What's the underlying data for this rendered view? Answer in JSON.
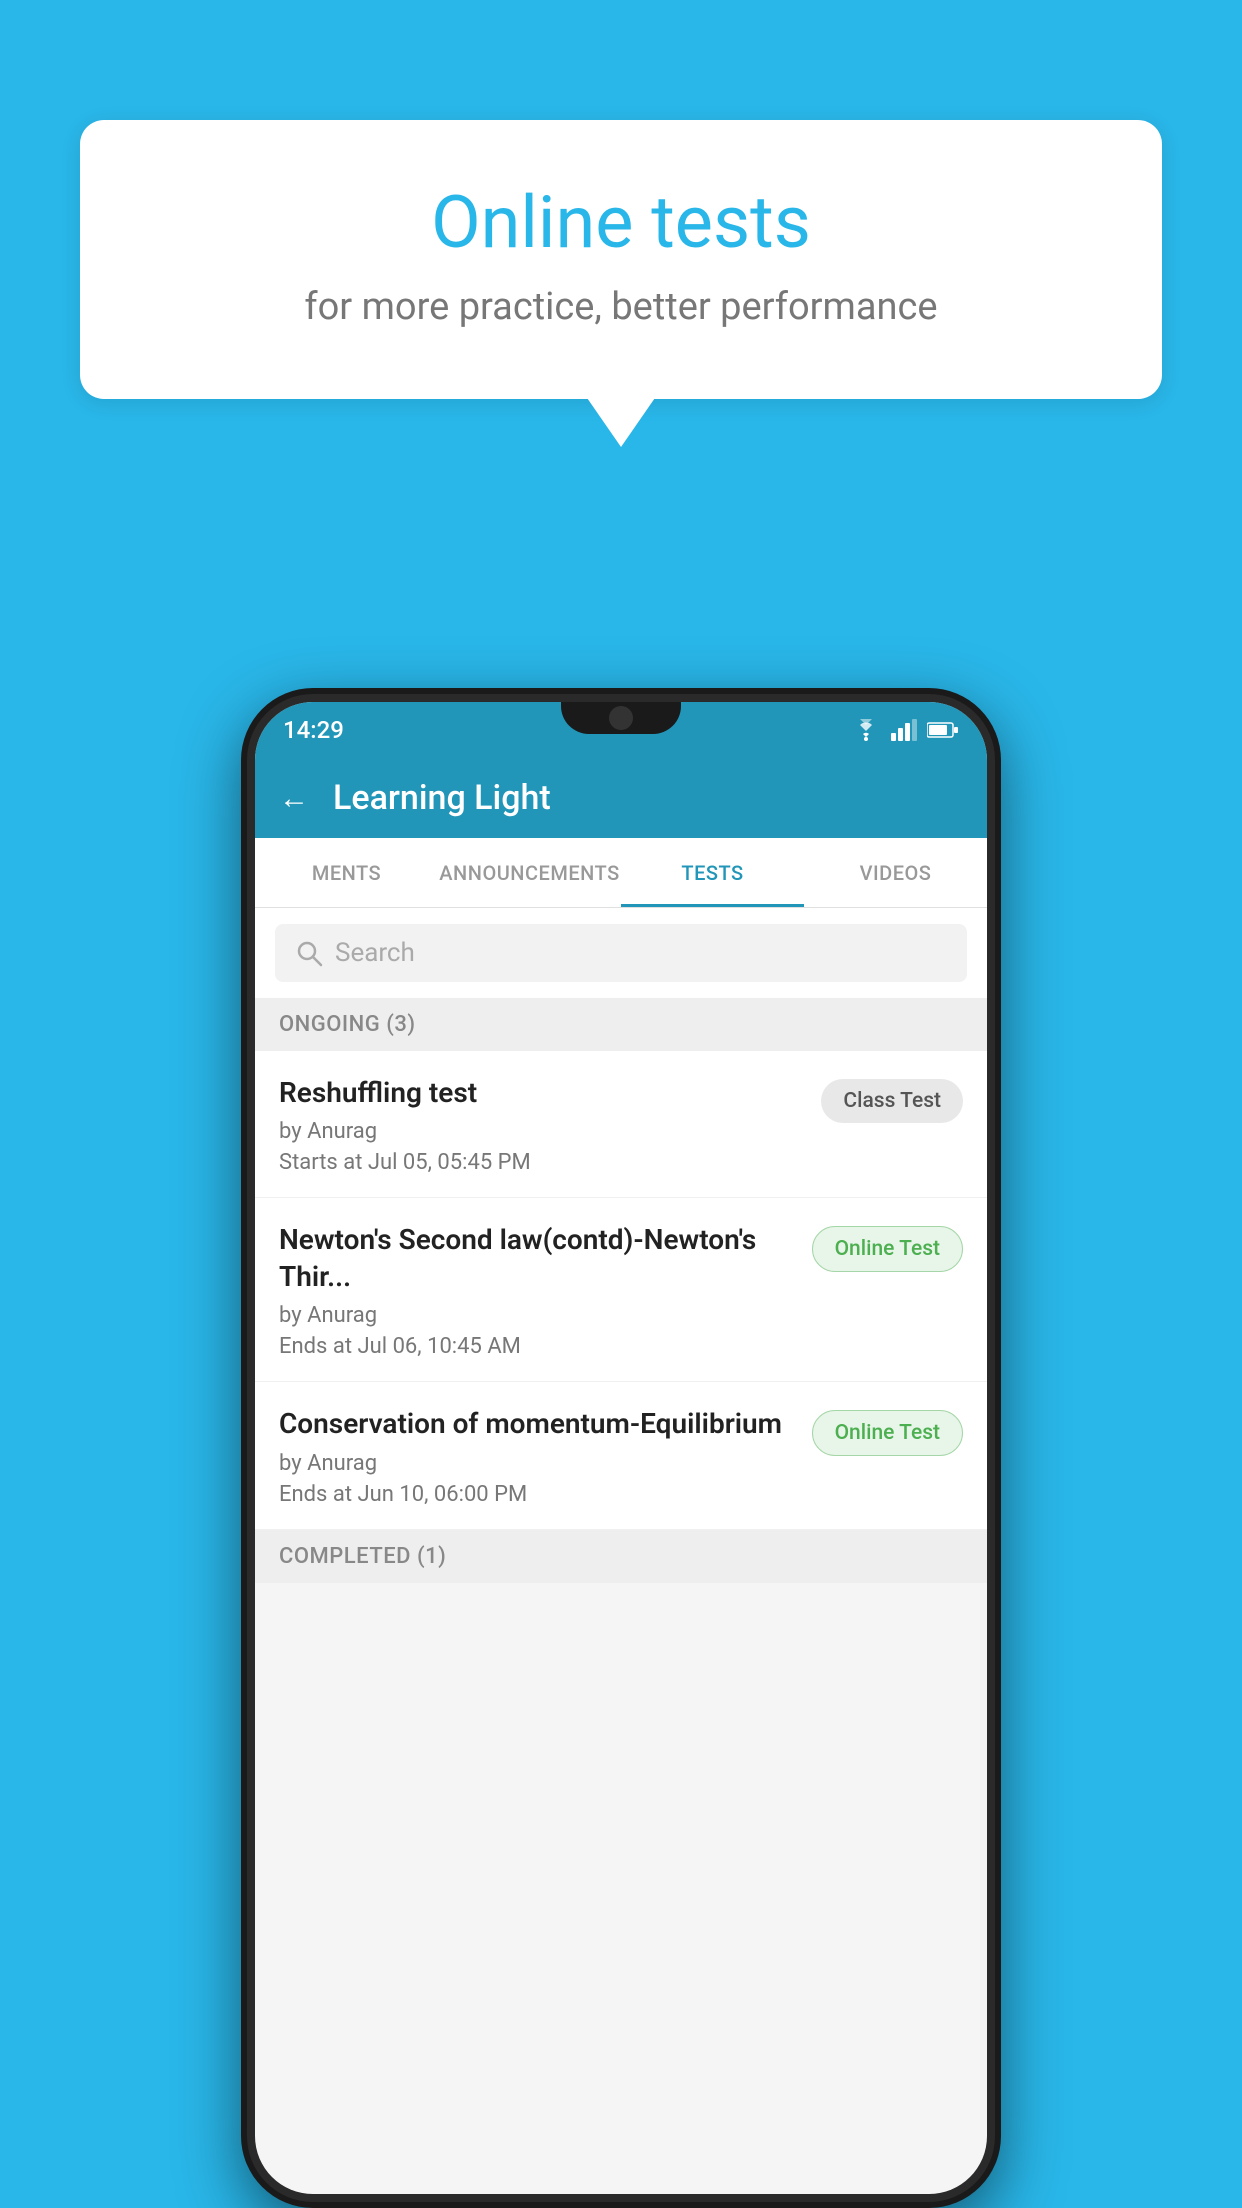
{
  "background": {
    "color": "#29B6E8"
  },
  "speech_bubble": {
    "title": "Online tests",
    "subtitle": "for more practice, better performance"
  },
  "phone": {
    "status_bar": {
      "time": "14:29",
      "icons": [
        "wifi",
        "signal",
        "battery"
      ]
    },
    "app_header": {
      "title": "Learning Light",
      "back_label": "←"
    },
    "tabs": [
      {
        "label": "MENTS",
        "active": false
      },
      {
        "label": "ANNOUNCEMENTS",
        "active": false
      },
      {
        "label": "TESTS",
        "active": true
      },
      {
        "label": "VIDEOS",
        "active": false
      }
    ],
    "search": {
      "placeholder": "Search"
    },
    "ongoing_section": {
      "label": "ONGOING (3)",
      "tests": [
        {
          "name": "Reshuffling test",
          "by": "by Anurag",
          "time": "Starts at  Jul 05, 05:45 PM",
          "badge": "Class Test",
          "badge_type": "class"
        },
        {
          "name": "Newton's Second law(contd)-Newton's Thir...",
          "by": "by Anurag",
          "time": "Ends at  Jul 06, 10:45 AM",
          "badge": "Online Test",
          "badge_type": "online"
        },
        {
          "name": "Conservation of momentum-Equilibrium",
          "by": "by Anurag",
          "time": "Ends at  Jun 10, 06:00 PM",
          "badge": "Online Test",
          "badge_type": "online"
        }
      ]
    },
    "completed_section": {
      "label": "COMPLETED (1)"
    }
  }
}
